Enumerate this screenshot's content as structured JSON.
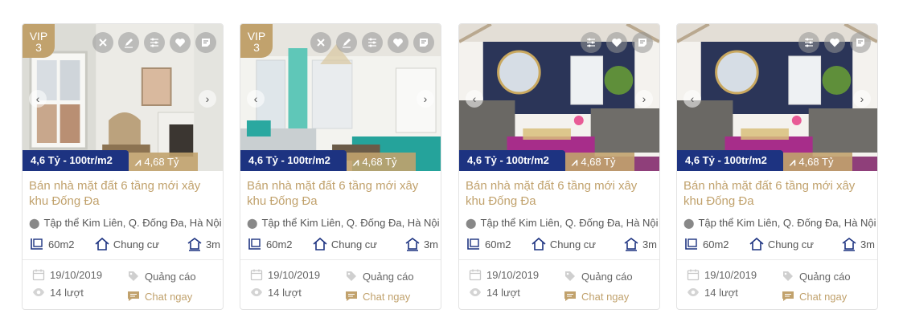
{
  "listings": [
    {
      "vip": {
        "label": "VIP",
        "level": "3"
      },
      "tools": [
        "close-icon",
        "edit-icon",
        "filter-icon",
        "heart-icon",
        "note-icon"
      ],
      "price": "4,6 Tỷ - 100tr/m2",
      "trend_value": "4,68 Tỷ",
      "title": "Bán nhà mặt đất 6 tầng mới xây khu Đống Đa",
      "address": "Tập thể Kim Liên, Q. Đống Đa, Hà Nội",
      "area": "60m2",
      "property_type": "Chung cư",
      "floors": "3m",
      "date": "19/10/2019",
      "ad_label": "Quảng cáo",
      "views": "14 lượt",
      "chat_label": "Chat ngay",
      "scene": "room-a"
    },
    {
      "vip": {
        "label": "VIP",
        "level": "3"
      },
      "tools": [
        "close-icon",
        "edit-icon",
        "filter-icon",
        "heart-icon",
        "note-icon"
      ],
      "price": "4,6 Tỷ - 100tr/m2",
      "trend_value": "4,68 Tỷ",
      "title": "Bán nhà mặt đất 6 tầng mới xây khu Đống Đa",
      "address": "Tập thể Kim Liên, Q. Đống Đa, Hà Nội",
      "area": "60m2",
      "property_type": "Chung cư",
      "floors": "3m",
      "date": "19/10/2019",
      "ad_label": "Quảng cáo",
      "views": "14 lượt",
      "chat_label": "Chat ngay",
      "scene": "room-b"
    },
    {
      "vip": null,
      "tools": [
        "filter-icon",
        "heart-icon",
        "note-icon"
      ],
      "price": "4,6 Tỷ - 100tr/m2",
      "trend_value": "4,68 Tỷ",
      "title": "Bán nhà mặt đất 6 tầng mới xây khu Đống Đa",
      "address": "Tập thể Kim Liên, Q. Đống Đa, Hà Nội",
      "area": "60m2",
      "property_type": "Chung cư",
      "floors": "3m",
      "date": "19/10/2019",
      "ad_label": "Quảng cáo",
      "views": "14 lượt",
      "chat_label": "Chat ngay",
      "scene": "room-c"
    },
    {
      "vip": null,
      "tools": [
        "filter-icon",
        "heart-icon",
        "note-icon"
      ],
      "price": "4,6 Tỷ - 100tr/m2",
      "trend_value": "4,68 Tỷ",
      "title": "Bán nhà mặt đất 6 tầng mới xây khu Đống Đa",
      "address": "Tập thể Kim Liên, Q. Đống Đa, Hà Nội",
      "area": "60m2",
      "property_type": "Chung cư",
      "floors": "3m",
      "date": "19/10/2019",
      "ad_label": "Quảng cáo",
      "views": "14 lượt",
      "chat_label": "Chat ngay",
      "scene": "room-c"
    }
  ],
  "colors": {
    "accent": "#c1a26d",
    "price_bg": "#1d3381"
  }
}
